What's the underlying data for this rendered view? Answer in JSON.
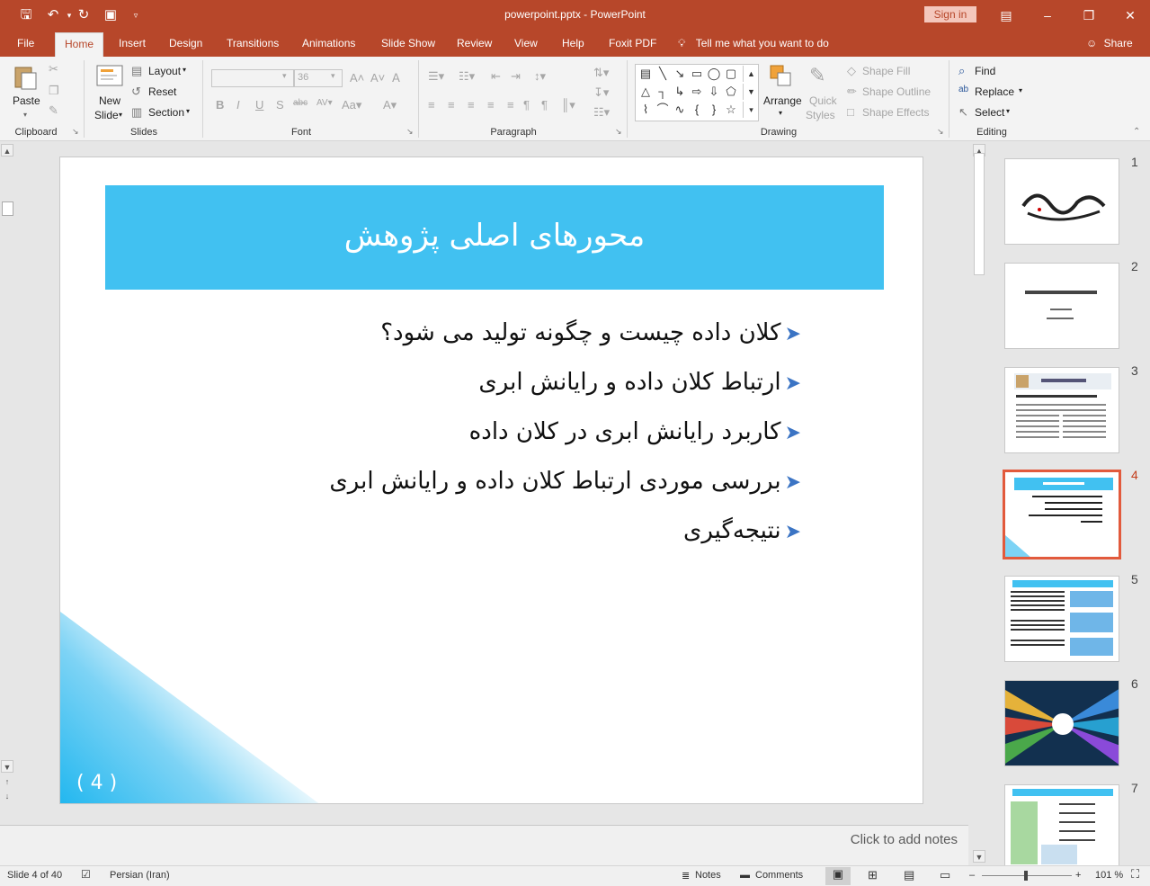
{
  "titlebar": {
    "doc_title": "powerpoint.pptx  -  PowerPoint",
    "sign_in": "Sign in",
    "qat": [
      "save-icon",
      "undo-icon",
      "redo-icon",
      "present-icon",
      "customize-icon"
    ]
  },
  "tabs": [
    "File",
    "Home",
    "Insert",
    "Design",
    "Transitions",
    "Animations",
    "Slide Show",
    "Review",
    "View",
    "Help",
    "Foxit PDF"
  ],
  "active_tab": "Home",
  "tell_me": "Tell me what you want to do",
  "share": "Share",
  "ribbon": {
    "clipboard": {
      "label": "Clipboard",
      "paste": "Paste"
    },
    "slides": {
      "label": "Slides",
      "new_slide_line1": "New",
      "new_slide_line2": "Slide",
      "layout": "Layout",
      "reset": "Reset",
      "section": "Section"
    },
    "font": {
      "label": "Font",
      "font_name": "",
      "font_size": "36"
    },
    "paragraph": {
      "label": "Paragraph"
    },
    "drawing": {
      "label": "Drawing",
      "arrange": "Arrange",
      "quick_styles_1": "Quick",
      "quick_styles_2": "Styles",
      "shape_fill": "Shape Fill",
      "shape_outline": "Shape Outline",
      "shape_effects": "Shape Effects"
    },
    "editing": {
      "label": "Editing",
      "find": "Find",
      "replace": "Replace",
      "select": "Select"
    }
  },
  "slide": {
    "title": "محورهای اصلی پژوهش",
    "bullets": [
      "کلان داده چیست و چگونه تولید می شود؟",
      "ارتباط کلان داده و رایانش ابری",
      "کاربرد رایانش ابری در کلان داده",
      "بررسی موردی ارتباط کلان داده و رایانش ابری",
      "نتیجه‌گیری"
    ],
    "number": "4",
    "accent_color": "#41c1f1"
  },
  "notes_placeholder": "Click to add notes",
  "thumbnails": [
    "1",
    "2",
    "3",
    "4",
    "5",
    "6",
    "7"
  ],
  "selected_thumbnail": "4",
  "statusbar": {
    "slide_info": "Slide 4 of 40",
    "language": "Persian (Iran)",
    "notes": "Notes",
    "comments": "Comments",
    "zoom": "101 %"
  }
}
